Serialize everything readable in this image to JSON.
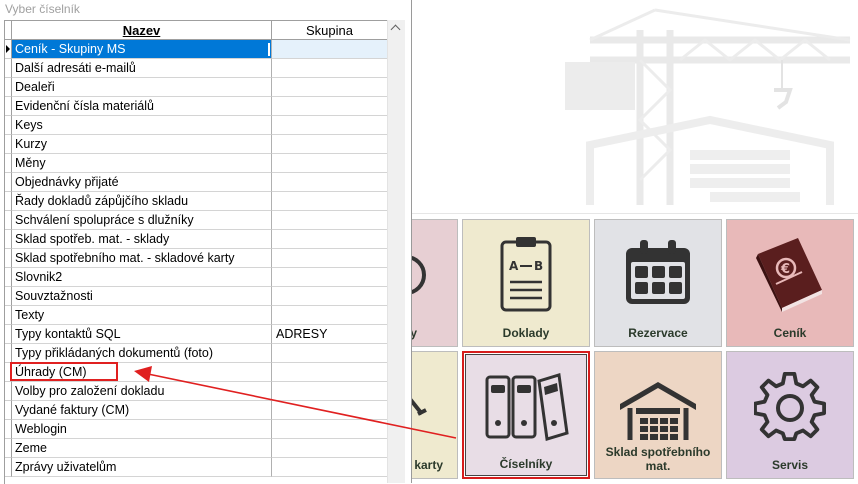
{
  "dialog": {
    "title": "Vyber číselník",
    "columns": {
      "nazev": "Nazev",
      "skupina": "Skupina"
    },
    "rows": [
      {
        "nazev": "Ceník - Skupiny MS",
        "skupina": ""
      },
      {
        "nazev": "Další adresáti e-mailů",
        "skupina": ""
      },
      {
        "nazev": "Dealeři",
        "skupina": ""
      },
      {
        "nazev": "Evidenční čísla materiálů",
        "skupina": ""
      },
      {
        "nazev": "Keys",
        "skupina": ""
      },
      {
        "nazev": "Kurzy",
        "skupina": ""
      },
      {
        "nazev": "Měny",
        "skupina": ""
      },
      {
        "nazev": "Objednávky přijaté",
        "skupina": ""
      },
      {
        "nazev": "Řady dokladů zápůjčího skladu",
        "skupina": ""
      },
      {
        "nazev": "Schválení spolupráce s dlužníky",
        "skupina": ""
      },
      {
        "nazev": "Sklad spotřeb. mat. - sklady",
        "skupina": ""
      },
      {
        "nazev": "Sklad spotřebního mat. - skladové karty",
        "skupina": ""
      },
      {
        "nazev": "Slovnik2",
        "skupina": ""
      },
      {
        "nazev": "Souvztažnosti",
        "skupina": ""
      },
      {
        "nazev": "Texty",
        "skupina": ""
      },
      {
        "nazev": "Typy kontaktů SQL",
        "skupina": "ADRESY"
      },
      {
        "nazev": "Typy přikládaných dokumentů (foto)",
        "skupina": ""
      },
      {
        "nazev": "Úhrady (CM)",
        "skupina": ""
      },
      {
        "nazev": "Volby pro založení dokladu",
        "skupina": ""
      },
      {
        "nazev": "Vydané faktury (CM)",
        "skupina": ""
      },
      {
        "nazev": "Weblogin",
        "skupina": ""
      },
      {
        "nazev": "Zeme",
        "skupina": ""
      },
      {
        "nazev": "Zprávy uživatelům",
        "skupina": ""
      }
    ]
  },
  "tiles": {
    "partial_top": "y",
    "doklady": "Doklady",
    "rezervace": "Rezervace",
    "cenik": "Ceník",
    "partial_bottom": "karty",
    "ciselniky": "Číselníky",
    "sklad": "Sklad spotřebního mat.",
    "servis": "Servis"
  },
  "colors": {
    "tile_pink": "#e7cfd3",
    "tile_cream": "#efeacf",
    "tile_grey": "#e1e2e6",
    "tile_rose": "#e8b9b9",
    "tile_lilac": "#e8dde6",
    "tile_peach": "#edd6c4",
    "tile_lavender": "#dccbe1",
    "selection_blue": "#0078d7",
    "annotation_red": "#e02020"
  },
  "icons": {
    "doklady": "clipboard-icon",
    "rezervace": "calendar-icon",
    "cenik": "price-book-icon",
    "ciselniky": "binders-icon",
    "sklad": "warehouse-icon",
    "servis": "gear-icon"
  }
}
